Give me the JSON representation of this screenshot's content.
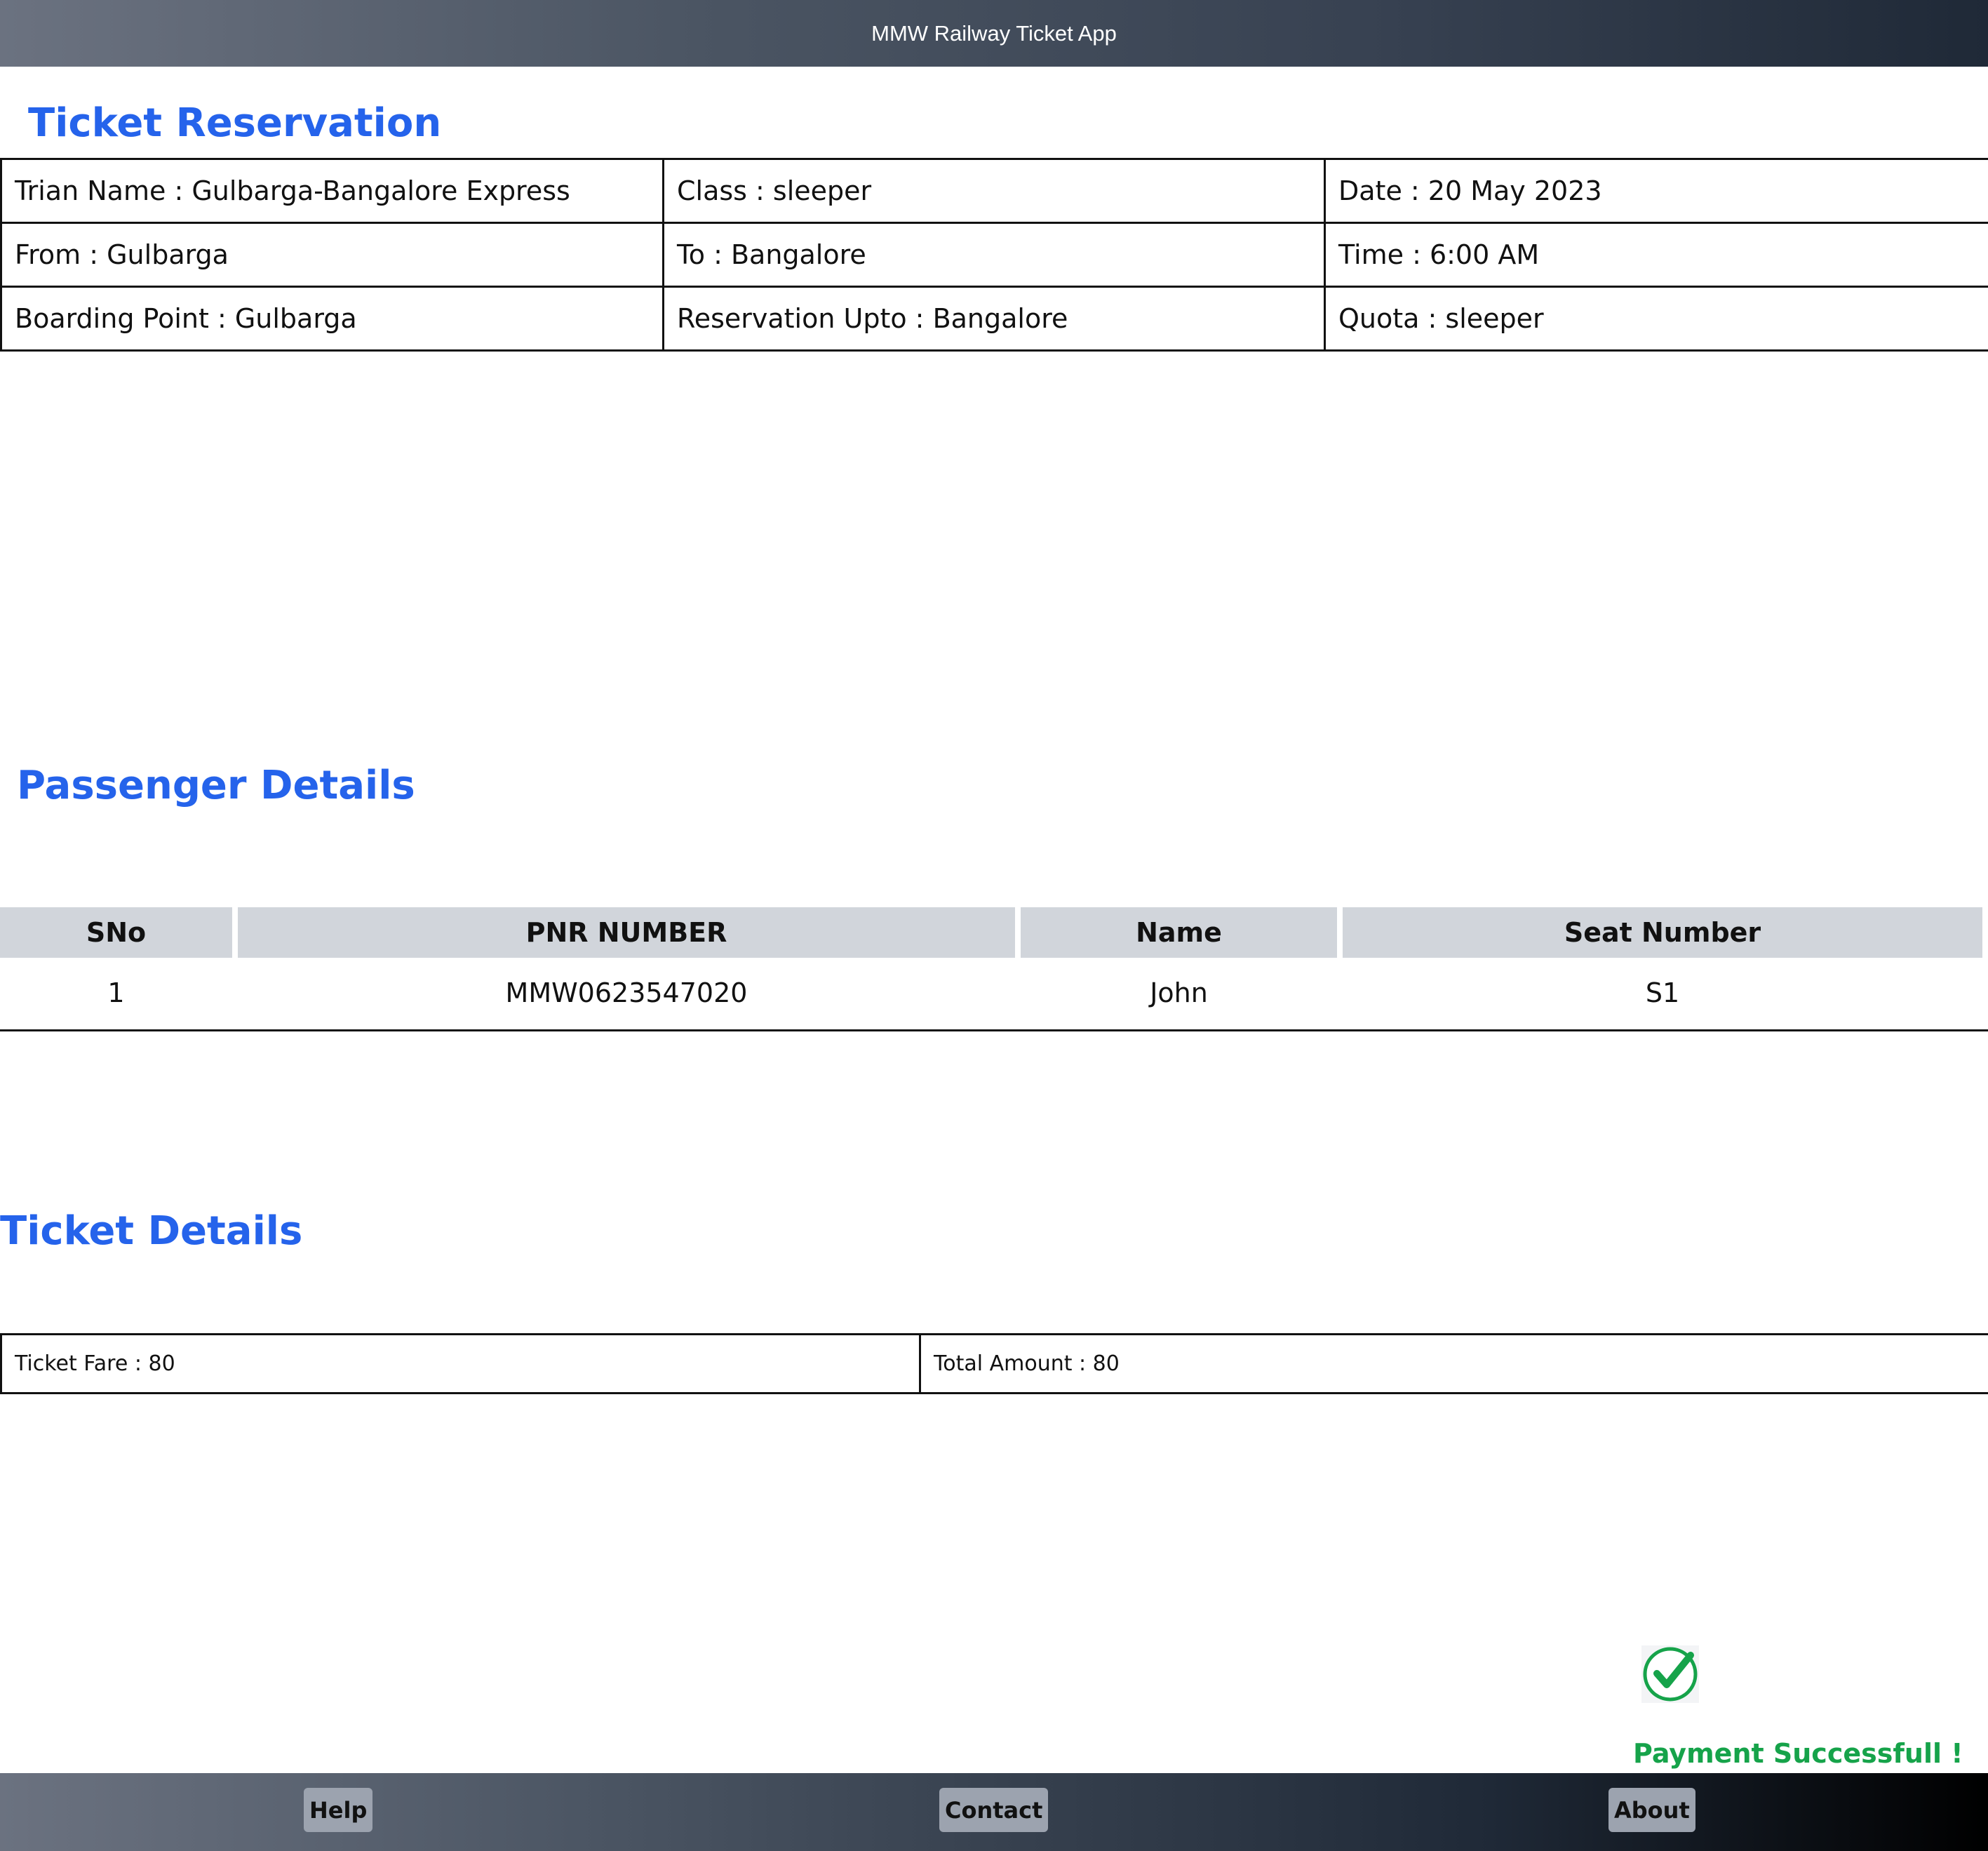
{
  "app": {
    "title": "MMW Railway Ticket App"
  },
  "reservation": {
    "heading": "Ticket Reservation",
    "rows": [
      [
        "Trian Name : Gulbarga-Bangalore Express",
        "Class : sleeper",
        "Date : 20 May 2023"
      ],
      [
        "From : Gulbarga",
        "To : Bangalore",
        "Time : 6:00 AM"
      ],
      [
        "Boarding Point : Gulbarga",
        "Reservation Upto : Bangalore",
        "Quota : sleeper"
      ]
    ]
  },
  "passengers": {
    "heading": "Passenger Details",
    "columns": [
      "SNo",
      "PNR NUMBER",
      "Name",
      "Seat Number"
    ],
    "rows": [
      [
        "1",
        "MMW0623547020",
        "John",
        "S1"
      ]
    ]
  },
  "ticket": {
    "heading": "Ticket Details",
    "fare": "Ticket Fare : 80",
    "total": "Total Amount : 80"
  },
  "payment": {
    "status_text": "Payment Successfull !",
    "icon": "check-circle-icon",
    "color": "#16a34a"
  },
  "footer": {
    "help": "Help",
    "contact": "Contact",
    "about": "About"
  },
  "colors": {
    "heading": "#2563eb",
    "table_header_bg": "#d1d5db"
  }
}
